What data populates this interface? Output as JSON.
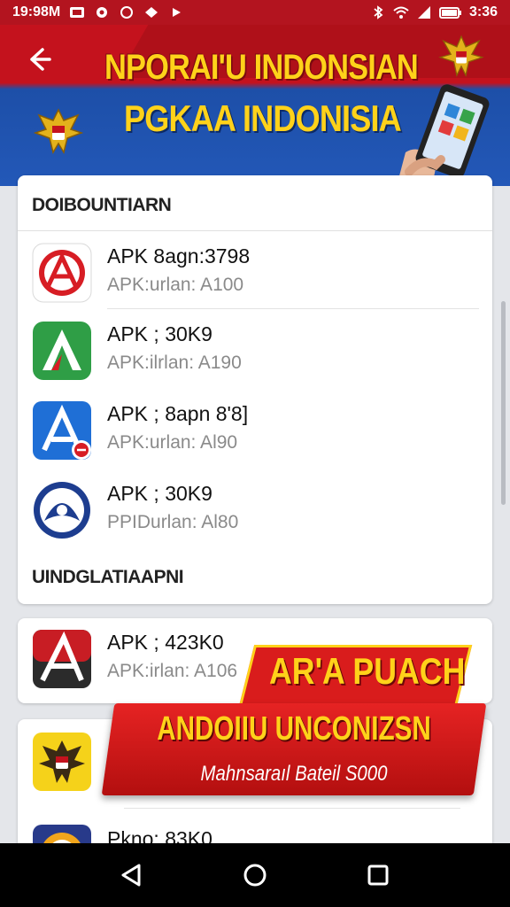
{
  "status_bar": {
    "time_left": "19:98M",
    "time_right": "3:36"
  },
  "banner": {
    "title_line1": "NPORAI'U INDONSIAN",
    "title_line2": "PGKAA INDONISIA"
  },
  "section_downloads": {
    "heading": "DOIBOUNTIARN",
    "items": [
      {
        "title": "APK 8agn:3798",
        "subtitle": "APK:urlan: A100",
        "icon": "red-a-app-icon"
      },
      {
        "title": "APK ; 30K9",
        "subtitle": "APK:ilrlan: A190",
        "icon": "green-a-app-icon"
      },
      {
        "title": "APK ; 8apn 8'8]",
        "subtitle": "APK:urlan: Al90",
        "icon": "blue-a-app-icon"
      },
      {
        "title": "APK ; 30K9",
        "subtitle": "PPIDurlan: Al80",
        "icon": "navy-circle-app-icon"
      }
    ]
  },
  "section_updates": {
    "heading": "UINDGLATIAAPNI",
    "items": [
      {
        "title": "APK ; 423K0",
        "subtitle": "APK:irlan: A106",
        "icon": "dark-red-a-app-icon"
      },
      {
        "title": "Pkno: 83K0",
        "subtitle": "",
        "icon": "garuda-app-icon"
      }
    ]
  },
  "promo": {
    "top_text": "AR'A PUACH",
    "main_text": "ANDOIIU UNCONIZSN",
    "sub_text": "Mahnsaraıl Bateil S000"
  },
  "colors": {
    "brand_red": "#c4121d",
    "brand_blue": "#2358b8",
    "accent_yellow": "#ffd21a"
  }
}
